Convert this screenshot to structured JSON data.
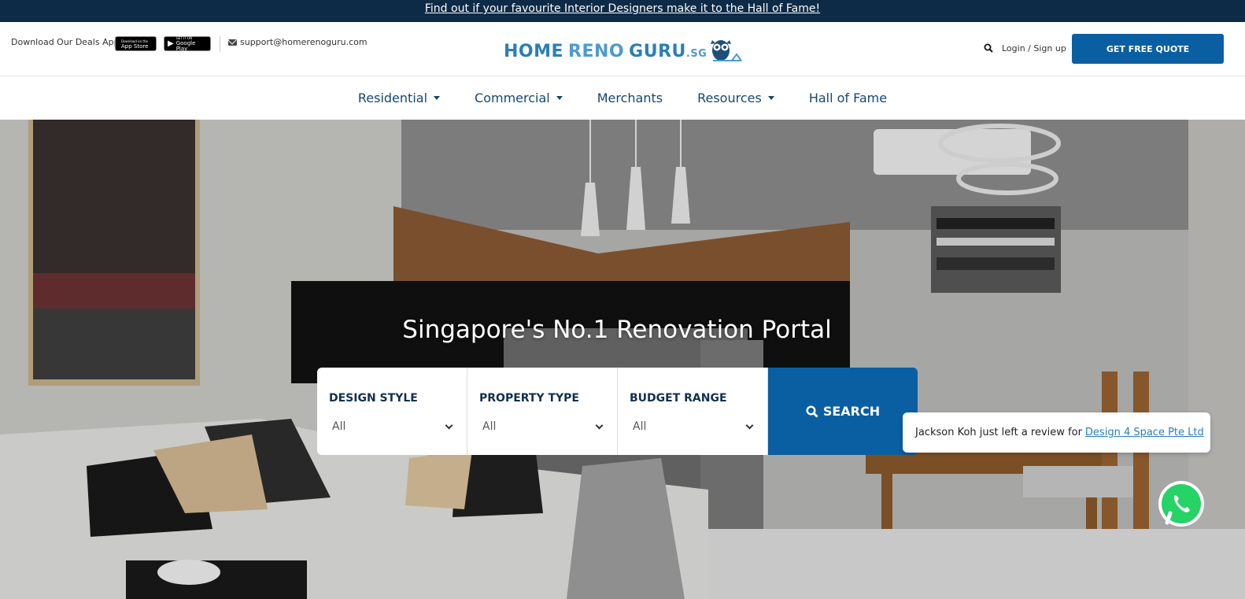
{
  "announcement": {
    "text": "Find out if your favourite Interior Designers make it to the Hall of Fame!"
  },
  "header": {
    "download_text": "Download Our Deals App",
    "app_store": {
      "small": "Download on the",
      "big": "App Store"
    },
    "google_play": {
      "small": "GET IT ON",
      "big": "Google Play"
    },
    "email": "support@homerenoguru.com",
    "logo": {
      "home": "HOME",
      "reno": "RENO",
      "guru": "GURU",
      "sg": ".SG"
    },
    "login": "Login / Sign up",
    "quote_button": "GET FREE QUOTE"
  },
  "nav": {
    "items": [
      {
        "label": "Residential",
        "dropdown": true
      },
      {
        "label": "Commercial",
        "dropdown": true
      },
      {
        "label": "Merchants",
        "dropdown": false
      },
      {
        "label": "Resources",
        "dropdown": true
      },
      {
        "label": "Hall of Fame",
        "dropdown": false
      }
    ]
  },
  "hero": {
    "title": "Singapore's No.1 Renovation Portal",
    "filters": [
      {
        "label": "DESIGN STYLE",
        "value": "All"
      },
      {
        "label": "PROPERTY TYPE",
        "value": "All"
      },
      {
        "label": "BUDGET RANGE",
        "value": "All"
      }
    ],
    "search_button": "SEARCH"
  },
  "toast": {
    "text": "Jackson Koh just left a review for",
    "link": "Design 4 Space Pte Ltd"
  },
  "colors": {
    "primary": "#0a5fa3",
    "dark": "#0d2a47",
    "nav_text": "#16476f",
    "whatsapp": "#25d366"
  }
}
